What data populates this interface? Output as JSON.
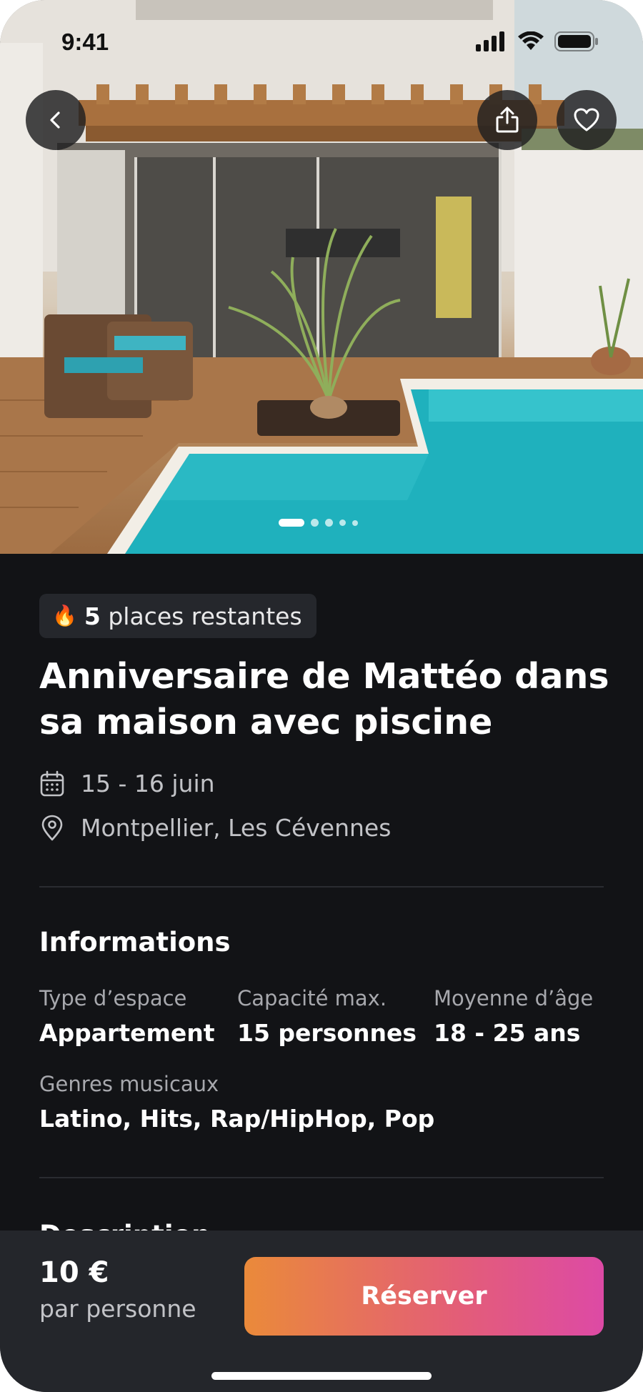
{
  "status_bar": {
    "time": "9:41"
  },
  "hero": {
    "carousel_total": 5,
    "carousel_active_index": 0
  },
  "badge": {
    "count": "5",
    "text": " places restantes"
  },
  "event": {
    "title": "Anniversaire de Mattéo dans sa maison avec piscine",
    "date": "15 - 16 juin",
    "location": "Montpellier, Les Cévennes"
  },
  "informations": {
    "heading": "Informations",
    "space_type": {
      "label": "Type d’espace",
      "value": "Appartement"
    },
    "capacity": {
      "label": "Capacité max.",
      "value": "15 personnes"
    },
    "age": {
      "label": "Moyenne d’âge",
      "value": "18 - 25 ans"
    },
    "genres": {
      "label": "Genres musicaux",
      "value": "Latino, Hits, Rap/HipHop, Pop"
    }
  },
  "description": {
    "heading": "Description"
  },
  "booking": {
    "price": "10 €",
    "price_unit": "par personne",
    "reserve_label": "Réserver"
  },
  "icons": {
    "back": "chevron-left-icon",
    "share": "share-icon",
    "favorite": "heart-icon",
    "calendar": "calendar-icon",
    "location": "location-pin-icon",
    "fire": "fire-icon"
  },
  "colors": {
    "background": "#121316",
    "bottom_bar": "#24262b",
    "cta_gradient_start": "#ea8a3a",
    "cta_gradient_end": "#dd4aa5"
  }
}
